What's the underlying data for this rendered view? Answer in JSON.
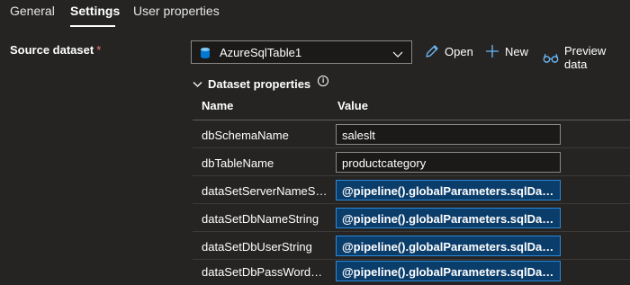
{
  "tabs": [
    {
      "label": "General",
      "active": false
    },
    {
      "label": "Settings",
      "active": true
    },
    {
      "label": "User properties",
      "active": false
    }
  ],
  "source": {
    "label": "Source dataset",
    "required_marker": "*",
    "value": "AzureSqlTable1"
  },
  "actions": {
    "open": "Open",
    "new": "New",
    "preview": "Preview data"
  },
  "dataset_properties": {
    "title": "Dataset properties",
    "info": "i",
    "columns": {
      "name": "Name",
      "value": "Value"
    },
    "rows": [
      {
        "name": "dbSchemaName",
        "value": "saleslt"
      },
      {
        "name": "dbTableName",
        "value": "productcategory"
      },
      {
        "name": "dataSetServerNameStri...",
        "value": "@pipeline().globalParameters.sqlDat..."
      },
      {
        "name": "dataSetDbNameString",
        "value": "@pipeline().globalParameters.sqlDat..."
      },
      {
        "name": "dataSetDbUserString",
        "value": "@pipeline().globalParameters.sqlDat..."
      },
      {
        "name": "dataSetDbPassWordStr...",
        "value": "@pipeline().globalParameters.sqlDat..."
      }
    ]
  },
  "colors": {
    "background": "#252423",
    "accent": "#2b88d8",
    "expression_bg": "#0b3d6b",
    "required": "#f1707b"
  },
  "icons": [
    "database-icon",
    "chevron-down-icon",
    "pencil-icon",
    "plus-icon",
    "glasses-icon",
    "chevron-down-icon",
    "info-icon"
  ]
}
